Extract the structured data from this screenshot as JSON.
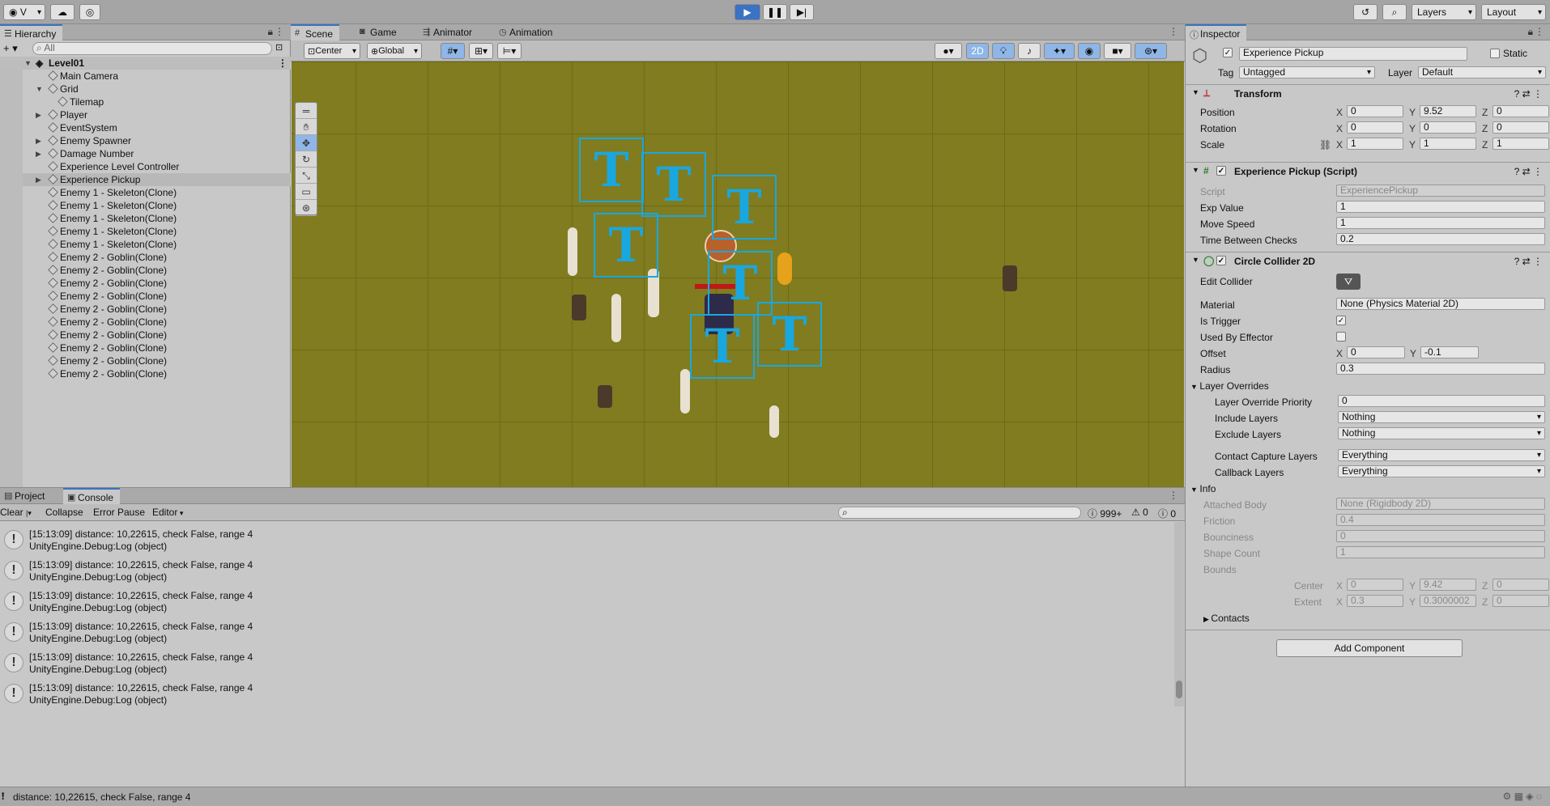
{
  "toolbar": {
    "account": "V",
    "layers": "Layers",
    "layout": "Layout"
  },
  "hierarchy": {
    "tab": "Hierarchy",
    "search_placeholder": "All",
    "root": "Level01",
    "items": [
      "Main Camera",
      "Grid",
      "Tilemap",
      "Player",
      "EventSystem",
      "Enemy Spawner",
      "Damage Number",
      "Experience Level Controller",
      "Experience Pickup",
      "Enemy 1 - Skeleton(Clone)",
      "Enemy 1 - Skeleton(Clone)",
      "Enemy 1 - Skeleton(Clone)",
      "Enemy 1 - Skeleton(Clone)",
      "Enemy 1 - Skeleton(Clone)",
      "Enemy 2 - Goblin(Clone)",
      "Enemy 2 - Goblin(Clone)",
      "Enemy 2 - Goblin(Clone)",
      "Enemy 2 - Goblin(Clone)",
      "Enemy 2 - Goblin(Clone)",
      "Enemy 2 - Goblin(Clone)",
      "Enemy 2 - Goblin(Clone)",
      "Enemy 2 - Goblin(Clone)",
      "Enemy 2 - Goblin(Clone)",
      "Enemy 2 - Goblin(Clone)"
    ]
  },
  "scene": {
    "tabs": [
      "Scene",
      "Game",
      "Animator",
      "Animation"
    ],
    "pivot": "Center",
    "space": "Global",
    "mode2d": "2D",
    "marker_text": "T"
  },
  "inspector": {
    "tab": "Inspector",
    "object_name": "Experience Pickup",
    "static_label": "Static",
    "tag_label": "Tag",
    "tag": "Untagged",
    "layer_label": "Layer",
    "layer": "Default",
    "transform": {
      "title": "Transform",
      "position_label": "Position",
      "rotation_label": "Rotation",
      "scale_label": "Scale",
      "position": [
        "0",
        "9.52",
        "0"
      ],
      "rotation": [
        "0",
        "0",
        "0"
      ],
      "scale": [
        "1",
        "1",
        "1"
      ]
    },
    "script_comp": {
      "title": "Experience Pickup (Script)",
      "script_label": "Script",
      "script": "ExperiencePickup",
      "exp_label": "Exp Value",
      "exp": "1",
      "speed_label": "Move Speed",
      "speed": "1",
      "time_label": "Time Between Checks",
      "time": "0.2"
    },
    "collider": {
      "title": "Circle Collider 2D",
      "edit_label": "Edit Collider",
      "material_label": "Material",
      "material": "None (Physics Material 2D)",
      "trigger_label": "Is Trigger",
      "effector_label": "Used By Effector",
      "offset_label": "Offset",
      "offset": [
        "0",
        "-0.1"
      ],
      "radius_label": "Radius",
      "radius": "0.3",
      "overrides_label": "Layer Overrides",
      "priority_label": "Layer Override Priority",
      "priority": "0",
      "include_label": "Include Layers",
      "include": "Nothing",
      "exclude_label": "Exclude Layers",
      "exclude": "Nothing",
      "capture_label": "Contact Capture Layers",
      "capture": "Everything",
      "callback_label": "Callback Layers",
      "callback": "Everything",
      "info_label": "Info",
      "body_label": "Attached Body",
      "body": "None (Rigidbody 2D)",
      "friction_label": "Friction",
      "friction": "0.4",
      "bounce_label": "Bounciness",
      "bounce": "0",
      "shape_label": "Shape Count",
      "shape": "1",
      "bounds_label": "Bounds",
      "center_label": "Center",
      "center": [
        "0",
        "9.42",
        "0"
      ],
      "extent_label": "Extent",
      "extent": [
        "0.3",
        "0.3000002",
        "0"
      ],
      "contacts_label": "Contacts"
    },
    "add_component": "Add Component"
  },
  "console": {
    "tabs": [
      "Project",
      "Console"
    ],
    "clear": "Clear",
    "collapse": "Collapse",
    "error_pause": "Error Pause",
    "editor": "Editor",
    "count_log": "999+",
    "count_warn": "0",
    "count_err": "0",
    "entries": [
      {
        "l1": "[15:13:09] distance: 10,22615, check False, range 4",
        "l2": "UnityEngine.Debug:Log (object)"
      },
      {
        "l1": "[15:13:09] distance: 10,22615, check False, range 4",
        "l2": "UnityEngine.Debug:Log (object)"
      },
      {
        "l1": "[15:13:09] distance: 10,22615, check False, range 4",
        "l2": "UnityEngine.Debug:Log (object)"
      },
      {
        "l1": "[15:13:09] distance: 10,22615, check False, range 4",
        "l2": "UnityEngine.Debug:Log (object)"
      },
      {
        "l1": "[15:13:09] distance: 10,22615, check False, range 4",
        "l2": "UnityEngine.Debug:Log (object)"
      },
      {
        "l1": "[15:13:09] distance: 10,22615, check False, range 4",
        "l2": "UnityEngine.Debug:Log (object)"
      }
    ]
  },
  "status": "distance: 10,22615, check False, range 4"
}
